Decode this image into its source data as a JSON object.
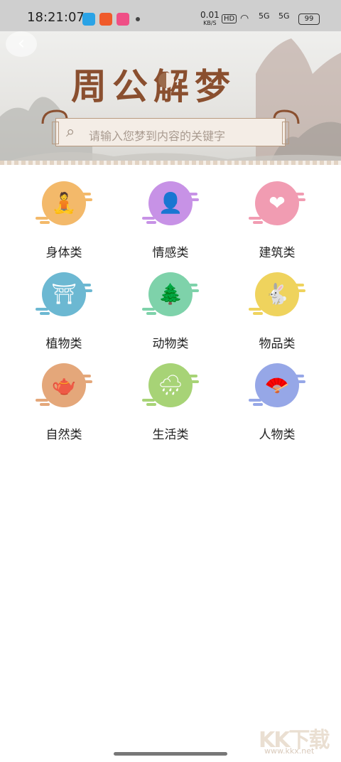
{
  "status_bar": {
    "time": "18:21:07",
    "speed_value": "0.01",
    "speed_unit": "KB/S",
    "hd": "HD",
    "signal1": "5G",
    "signal2": "5G",
    "battery": "99"
  },
  "header": {
    "title": "周公解梦",
    "search_placeholder": "请输入您梦到内容的关键字"
  },
  "categories": [
    {
      "label": "身体类",
      "color": "#f3b96a",
      "icon": "meditation-icon"
    },
    {
      "label": "情感类",
      "color": "#c792e6",
      "icon": "person-icon"
    },
    {
      "label": "建筑类",
      "color": "#f19cb2",
      "icon": "hearts-icon"
    },
    {
      "label": "植物类",
      "color": "#6cb8d2",
      "icon": "pavilion-icon"
    },
    {
      "label": "动物类",
      "color": "#7ed2aa",
      "icon": "tree-icon"
    },
    {
      "label": "物品类",
      "color": "#efd35d",
      "icon": "rabbit-icon"
    },
    {
      "label": "自然类",
      "color": "#e4a77a",
      "icon": "teapot-icon"
    },
    {
      "label": "生活类",
      "color": "#a7d376",
      "icon": "rain-cloud-icon"
    },
    {
      "label": "人物类",
      "color": "#96a7e7",
      "icon": "fan-icon"
    }
  ],
  "watermark": {
    "logo": "KK下载",
    "url": "www.kkx.net"
  }
}
